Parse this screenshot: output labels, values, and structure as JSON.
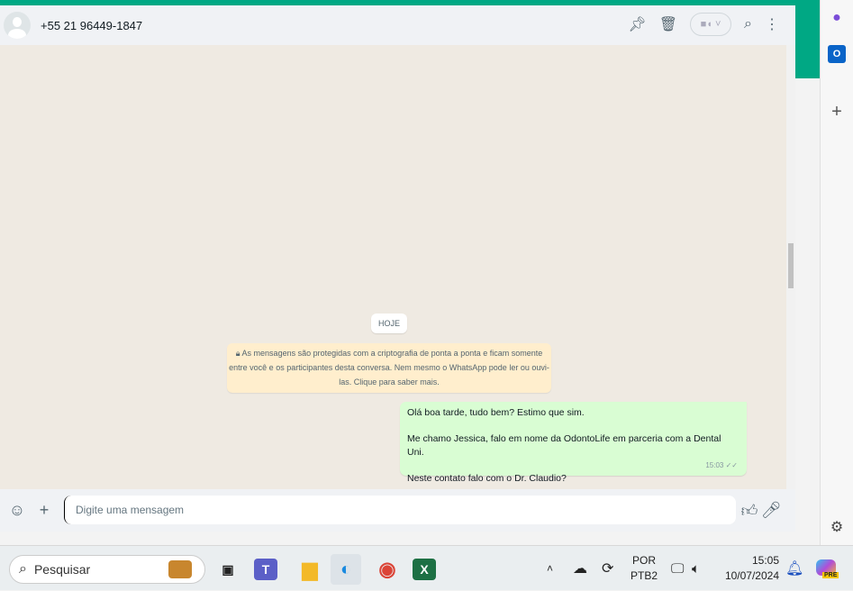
{
  "header": {
    "contact": "+55 21 96449-1847"
  },
  "chat": {
    "date_label": "HOJE",
    "encryption_notice": "As mensagens são protegidas com a criptografia de ponta a ponta e ficam somente entre você e os participantes desta conversa. Nem mesmo o WhatsApp pode ler ou ouvi-las. Clique para saber mais.",
    "messages": [
      {
        "lines": [
          "Olá boa tarde, tudo bem? Estimo que sim.",
          "Me chamo Jessica, falo em nome da OdontoLife em parceria com a Dental Uni.",
          "Neste contato falo com o Dr. Claudio?"
        ],
        "time": "15:03",
        "status": "read"
      }
    ]
  },
  "composer": {
    "placeholder": "Digite uma mensagem"
  },
  "taskbar": {
    "search_label": "Pesquisar",
    "lang_top": "POR",
    "lang_bottom": "PTB2",
    "time": "15:05",
    "date": "10/07/2024",
    "copilot_badge": "PRE"
  },
  "colors": {
    "accent": "#00a884",
    "bubble_out": "#d9fdd3",
    "notice": "#ffeecd",
    "chat_bg": "#efeae2"
  }
}
